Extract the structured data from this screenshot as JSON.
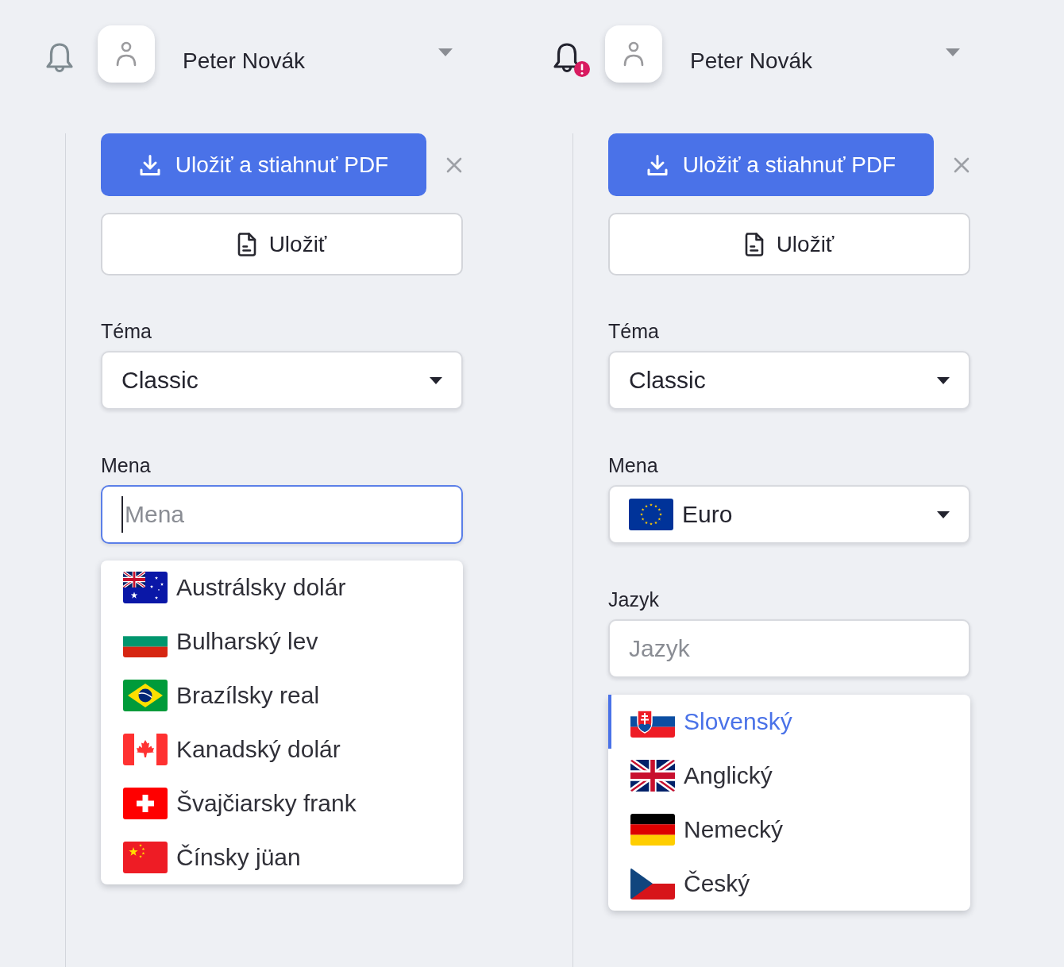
{
  "panels": [
    {
      "header": {
        "has_alert": false,
        "user_name": "Peter Novák"
      },
      "actions": {
        "primary": "Uložiť a stiahnuť PDF",
        "secondary": "Uložiť"
      },
      "fields": [
        {
          "kind": "select",
          "label": "Téma",
          "value": {
            "label": "Classic"
          }
        },
        {
          "kind": "search",
          "label": "Mena",
          "placeholder": "Mena",
          "focused": true,
          "options": [
            {
              "label": "Austrálsky dolár",
              "kind": "australia",
              "selected": false
            },
            {
              "label": "Bulharský lev",
              "kind": "bulgaria",
              "selected": false
            },
            {
              "label": "Brazílsky real",
              "kind": "brazil",
              "selected": false
            },
            {
              "label": "Kanadský dolár",
              "kind": "canada",
              "selected": false
            },
            {
              "label": "Švajčiarsky frank",
              "kind": "switzerland",
              "selected": false
            },
            {
              "label": "Čínsky jüan",
              "kind": "china",
              "selected": false
            }
          ]
        }
      ]
    },
    {
      "header": {
        "has_alert": true,
        "user_name": "Peter Novák"
      },
      "actions": {
        "primary": "Uložiť a stiahnuť PDF",
        "secondary": "Uložiť"
      },
      "fields": [
        {
          "kind": "select",
          "label": "Téma",
          "value": {
            "label": "Classic"
          }
        },
        {
          "kind": "select",
          "label": "Mena",
          "value": {
            "label": "Euro",
            "kind": "eu"
          }
        },
        {
          "kind": "search",
          "label": "Jazyk",
          "placeholder": "Jazyk",
          "focused": false,
          "options": [
            {
              "label": "Slovenský",
              "kind": "slovakia",
              "selected": true
            },
            {
              "label": "Anglický",
              "kind": "uk",
              "selected": false
            },
            {
              "label": "Nemecký",
              "kind": "germany",
              "selected": false
            },
            {
              "label": "Český",
              "kind": "czechia",
              "selected": false
            }
          ]
        }
      ]
    }
  ]
}
